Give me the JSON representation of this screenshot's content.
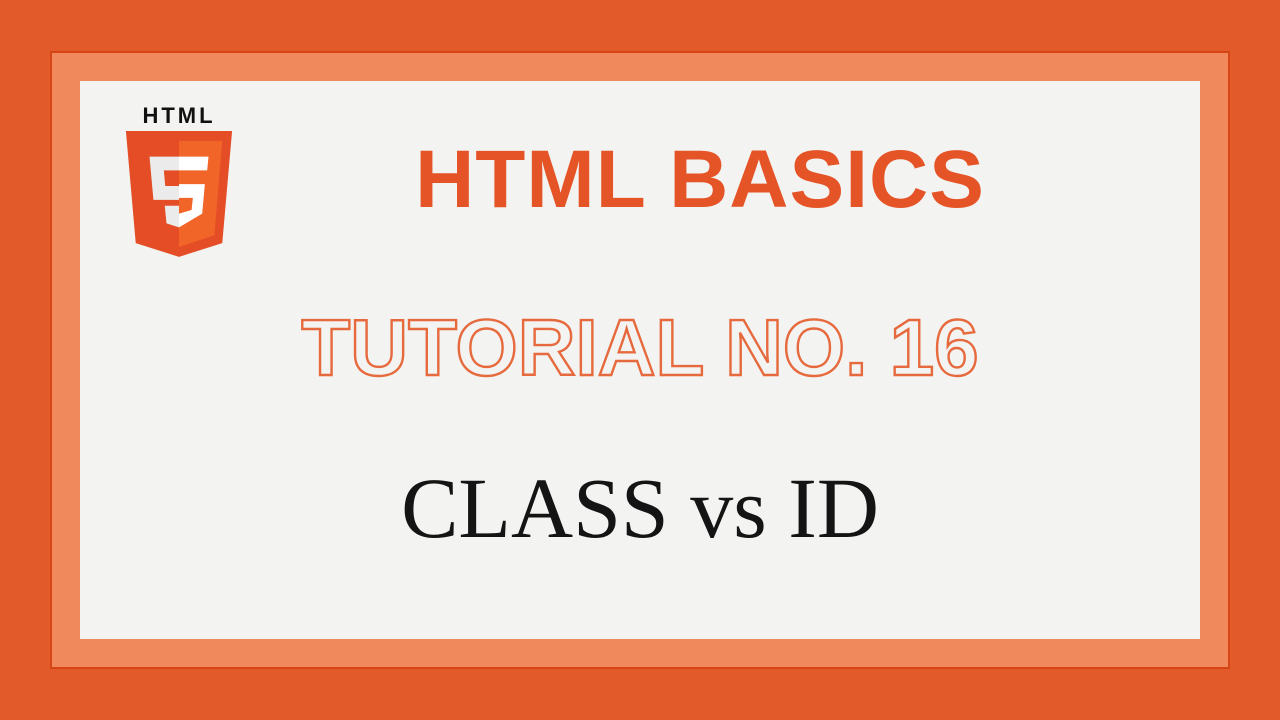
{
  "logo": {
    "label": "HTML",
    "digit": "5"
  },
  "title": "HTML BASICS",
  "subtitle": "TUTORIAL NO. 16",
  "topic": "CLASS vs ID",
  "colors": {
    "bg": "#e35a2a",
    "frame": "#f08a5d",
    "panel": "#f3f3f1",
    "accent": "#e55427",
    "dark": "#141415"
  }
}
